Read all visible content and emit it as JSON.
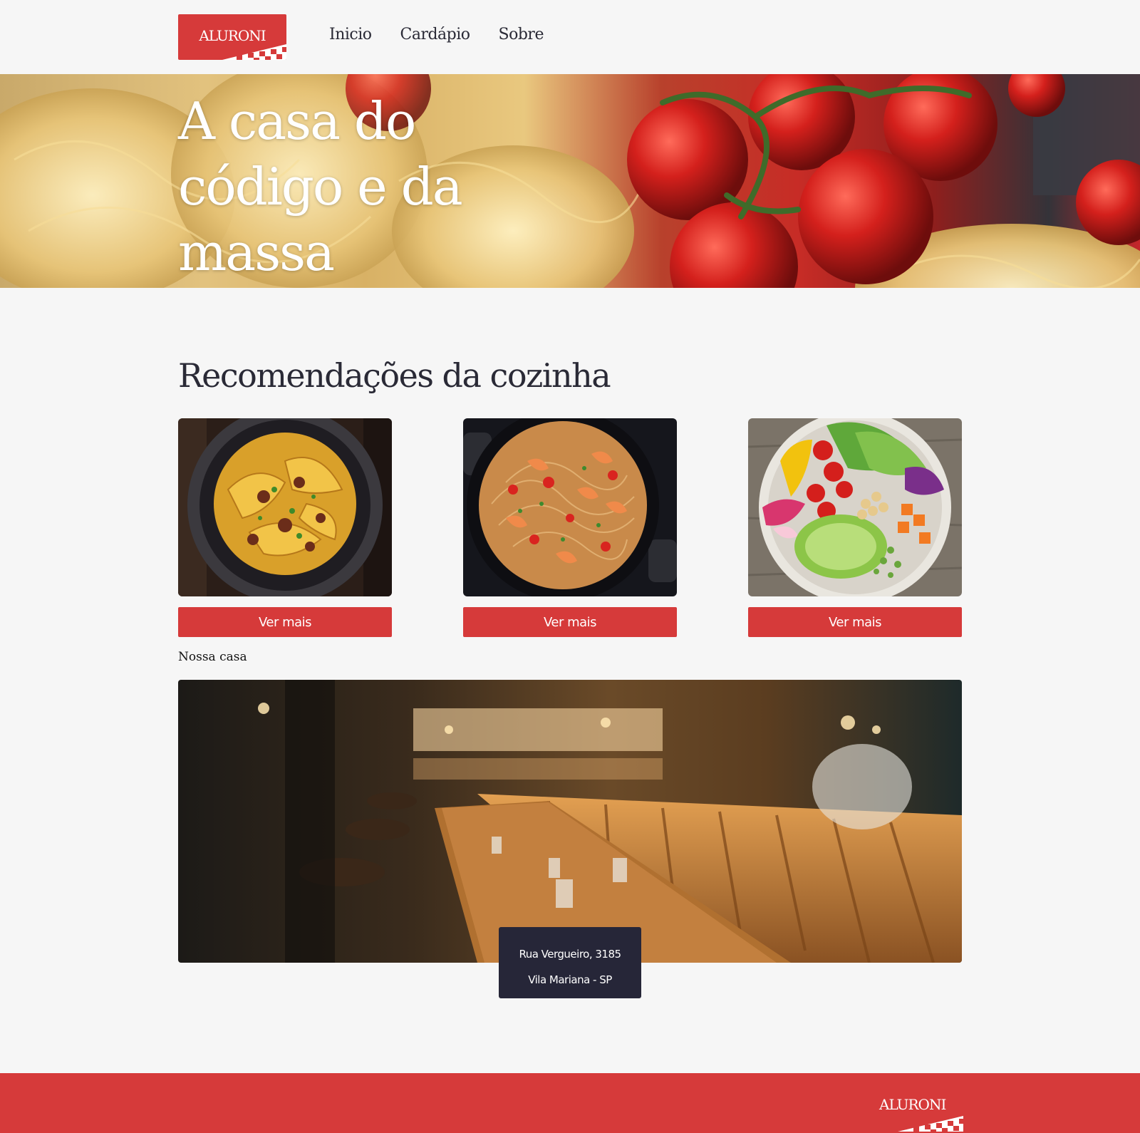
{
  "brand": {
    "name": "ALURONI",
    "color": "#d63a3a",
    "dark": "#262638",
    "background": "#f6f6f6"
  },
  "nav": {
    "items": [
      {
        "label": "Inicio"
      },
      {
        "label": "Cardápio"
      },
      {
        "label": "Sobre"
      }
    ]
  },
  "hero": {
    "title": "A casa do código e da massa"
  },
  "recommendations": {
    "title": "Recomendações da cozinha",
    "cards": [
      {
        "image": "tagliatelle-bolognese-photo",
        "button_label": "Ver mais"
      },
      {
        "image": "shrimp-spaghetti-pan-photo",
        "button_label": "Ver mais"
      },
      {
        "image": "vegetable-salad-bowl-photo",
        "button_label": "Ver mais"
      }
    ]
  },
  "our_house": {
    "label": "Nossa casa",
    "image": "restaurant-interior-photo",
    "address_line1": "Rua Vergueiro, 3185",
    "address_line2": "Vila Mariana - SP"
  },
  "footer": {
    "logo_text": "ALURONI"
  }
}
